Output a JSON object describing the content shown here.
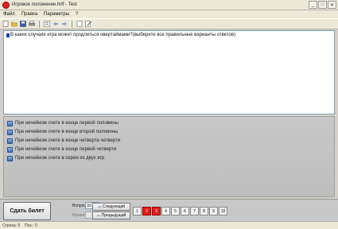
{
  "window": {
    "title": "Игровое положение.hrtf - Test",
    "min": "_",
    "max": "□",
    "close": "✕"
  },
  "menu": {
    "items": [
      "Файл",
      "Правка",
      "Параметры",
      "?"
    ]
  },
  "question": {
    "text": "В каких случаях игра может продлиться овертаймами?(выберите все правильные варианты ответов)"
  },
  "answers": [
    "При ничейном счете в конце первой половины",
    "При ничейном счете в конце второй половины",
    "При ничейном счете в конце четверта четверти",
    "При ничейном счете в конце первой четверти",
    "При ничейном счете в серии из двух игр"
  ],
  "bottom": {
    "submit_label": "Сдать билет",
    "question_no_label": "Вопрос №:",
    "question_no_value": "3/10",
    "time_label": "Время:",
    "next_label": "Следующий",
    "prev_label": "Предыдущий",
    "numbers": [
      "1",
      "2",
      "3",
      "4",
      "5",
      "6",
      "7",
      "8",
      "9",
      "10"
    ],
    "active_numbers": [
      "2",
      "3"
    ]
  },
  "status": {
    "row": "Строка:  9",
    "pos": "Поз.:  0"
  },
  "colors": {
    "accent_red": "#e21b1b",
    "checkbox_blue": "#3b6fb0"
  }
}
